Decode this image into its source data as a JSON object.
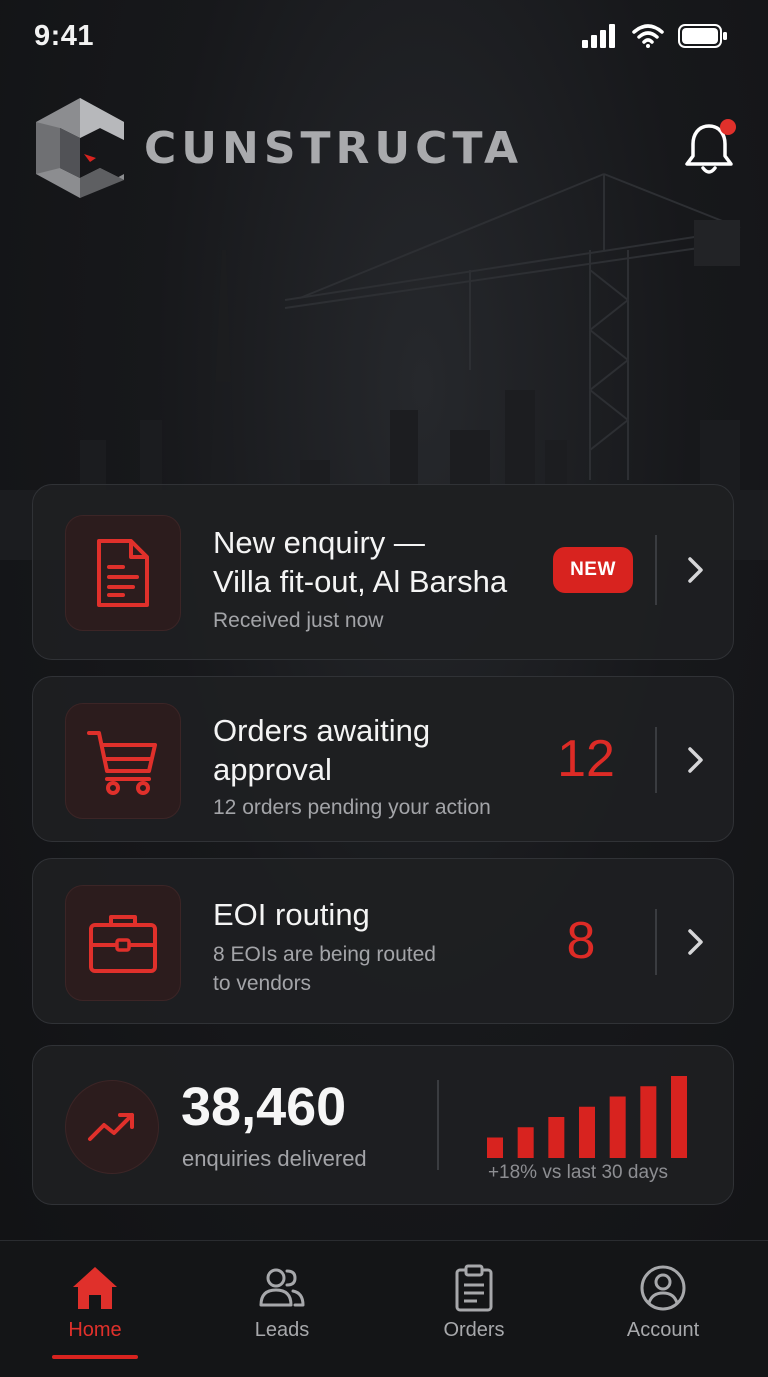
{
  "status_bar": {
    "time": "9:41"
  },
  "header": {
    "brand": "CUNSTRUCTA"
  },
  "colors": {
    "accent": "#d8231f",
    "background": "#121315",
    "card": "#1e1f22"
  },
  "cards": {
    "enquiry": {
      "icon": "document-icon",
      "title_line1": "New enquiry —",
      "title_line2": "Villa fit-out, Al Barsha",
      "subtitle": "Received just now",
      "badge": "NEW"
    },
    "orders": {
      "icon": "cart-icon",
      "title_line1": "Orders awaiting",
      "title_line2": "approval",
      "subtitle": "12 orders pending your action",
      "count": "12"
    },
    "eoi": {
      "icon": "briefcase-icon",
      "title": "EOI routing",
      "subtitle_line1": "8 EOIs are being routed",
      "subtitle_line2": "to vendors",
      "count": "8"
    }
  },
  "stats": {
    "icon": "trend-up-icon",
    "value": "38,460",
    "label": "enquiries delivered",
    "delta": "+18% vs last 30 days",
    "bars": [
      2,
      3,
      4,
      5,
      6,
      7,
      8
    ]
  },
  "tabs": [
    {
      "label": "Home",
      "icon": "home-icon",
      "active": true
    },
    {
      "label": "Leads",
      "icon": "users-icon",
      "active": false
    },
    {
      "label": "Orders",
      "icon": "clipboard-icon",
      "active": false
    },
    {
      "label": "Account",
      "icon": "user-circle-icon",
      "active": false
    }
  ]
}
